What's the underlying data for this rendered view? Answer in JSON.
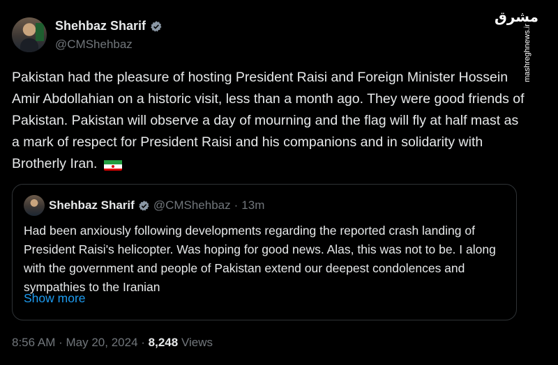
{
  "author": {
    "name": "Shehbaz Sharif",
    "handle": "@CMShehbaz",
    "verified_color": "#8b98a5"
  },
  "watermark": {
    "logo_text": "مشرق",
    "url": "mashreghnews.ir"
  },
  "tweet": {
    "text": "Pakistan had the pleasure of hosting President Raisi and Foreign Minister Hossein Amir Abdollahian on a historic visit, less than a month ago. They were good friends of Pakistan. Pakistan will observe a day of mourning and the flag will fly at half mast as a mark of respect for President Raisi and his companions and in solidarity with Brotherly Iran.",
    "emoji_icon": "iran-flag-icon"
  },
  "quote": {
    "name": "Shehbaz Sharif",
    "handle": "@CMShehbaz",
    "separator": "·",
    "age": "13m",
    "text": "Had been anxiously following developments regarding the reported crash landing of President Raisi's helicopter. Was hoping for good news. Alas, this was not to be. I along with the government and people of Pakistan extend our deepest condolences and sympathies to the Iranian",
    "show_more_label": "Show more"
  },
  "footer": {
    "time": "8:56 AM",
    "separator": "·",
    "date": "May 20, 2024",
    "views_count": "8,248",
    "views_label": "Views"
  },
  "colors": {
    "background": "#000000",
    "text": "#e7e9ea",
    "muted": "#71767b",
    "link": "#1d9bf0",
    "border": "#2f3336"
  }
}
